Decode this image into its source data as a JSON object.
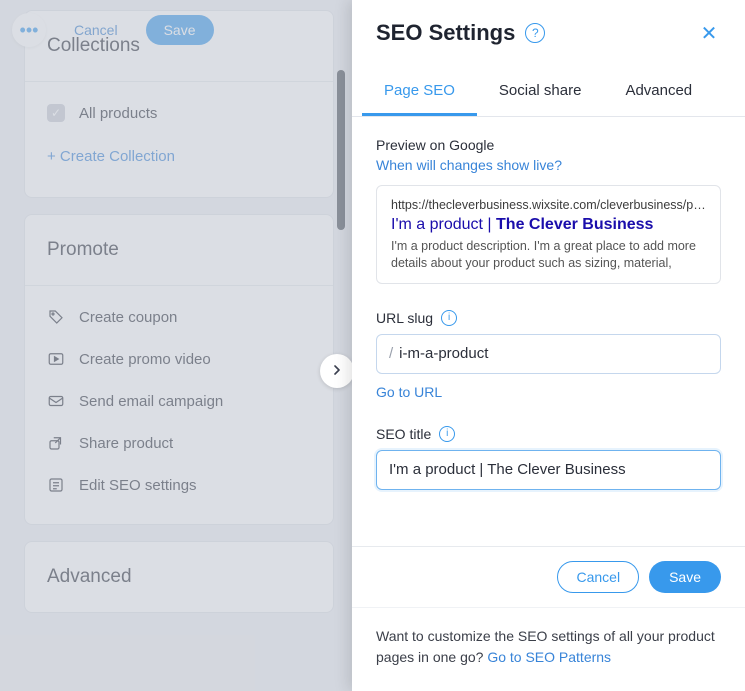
{
  "topbar": {
    "cancel": "Cancel",
    "save": "Save"
  },
  "left": {
    "collections_title": "Collections",
    "all_products": "All products",
    "create_collection": "+ Create Collection",
    "promote_title": "Promote",
    "promote_items": [
      {
        "icon": "tag",
        "label": "Create coupon"
      },
      {
        "icon": "play",
        "label": "Create promo video"
      },
      {
        "icon": "mail",
        "label": "Send email campaign"
      },
      {
        "icon": "share",
        "label": "Share product"
      },
      {
        "icon": "seo",
        "label": "Edit SEO settings"
      }
    ],
    "advanced_title": "Advanced"
  },
  "panel": {
    "title": "SEO Settings",
    "tabs": {
      "page": "Page SEO",
      "social": "Social share",
      "advanced": "Advanced"
    },
    "preview_label": "Preview on Google",
    "preview_link": "When will changes show live?",
    "preview": {
      "url": "https://thecleverbusiness.wixsite.com/cleverbusiness/pr...",
      "title_a": "I'm a product",
      "title_sep": " | ",
      "title_b": "The Clever Business",
      "desc": "I'm a product description. I'm a great place to add more details about your product such as sizing, material, care..."
    },
    "slug_label": "URL slug",
    "slug_value": "i-m-a-product",
    "go_to_url": "Go to URL",
    "seo_title_label": "SEO title",
    "seo_title_value": "I'm a product | The Clever Business",
    "footer_cancel": "Cancel",
    "footer_save": "Save",
    "note_text": "Want to customize the SEO settings of all your product pages in one go? ",
    "note_link": "Go to SEO Patterns"
  }
}
